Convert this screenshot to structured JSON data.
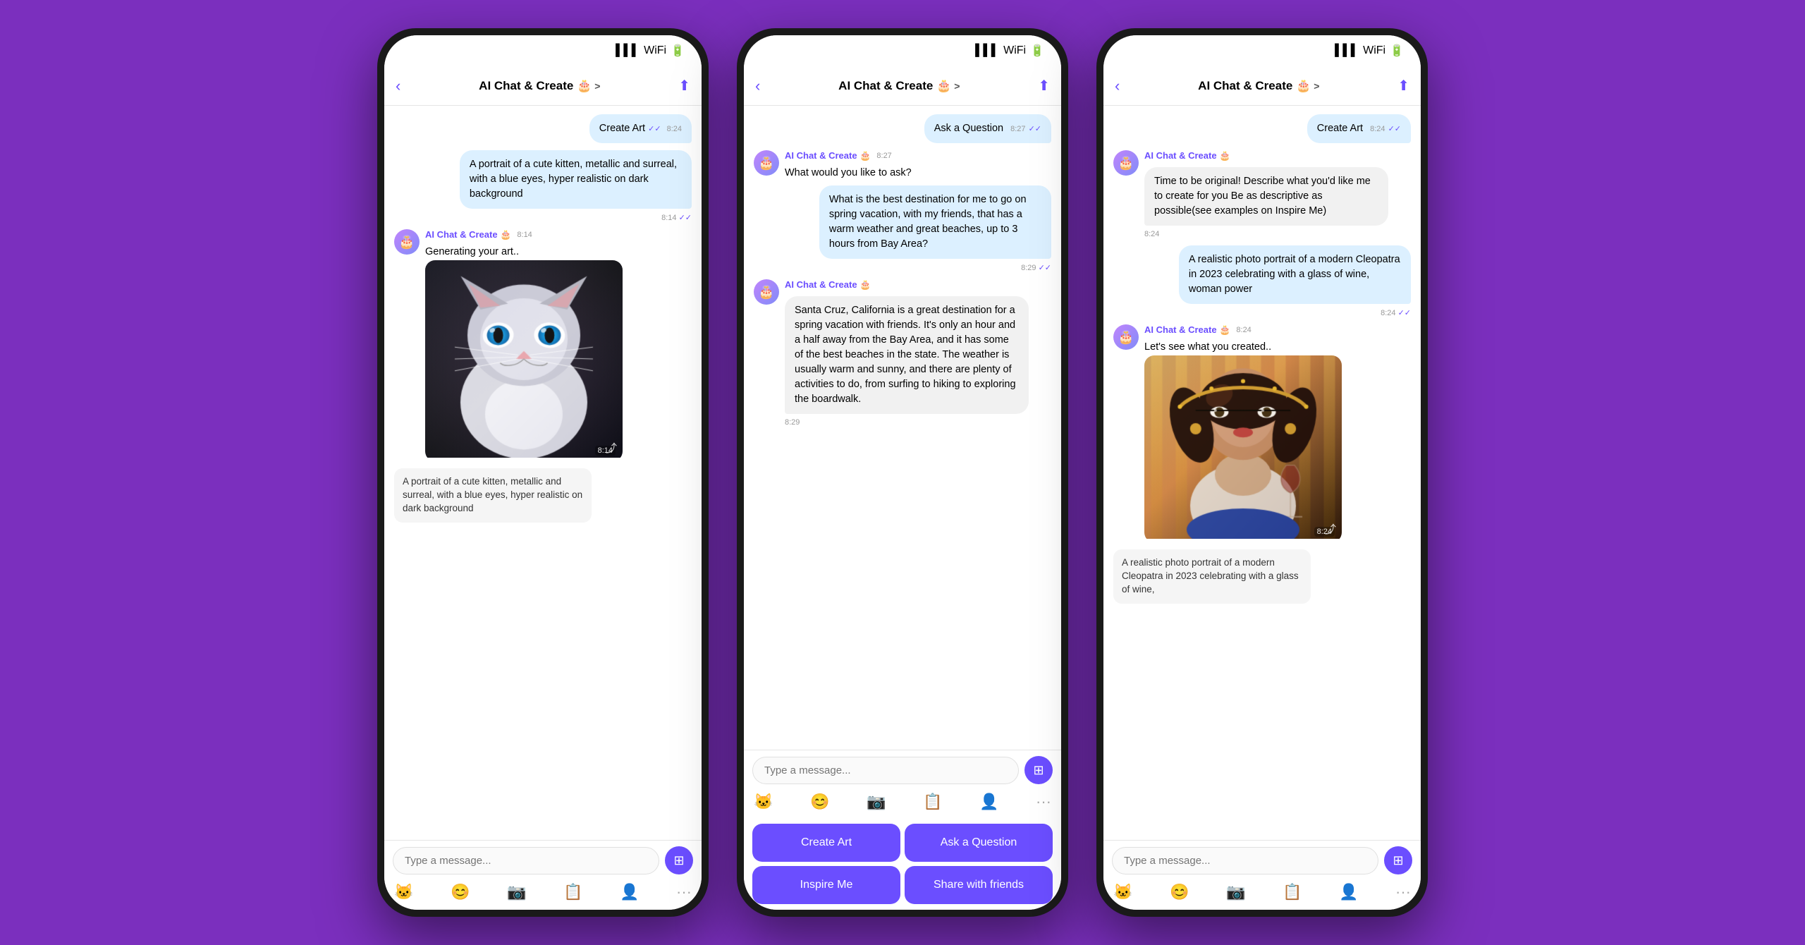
{
  "app": {
    "name": "AI Chat & Create",
    "emoji": "🎂",
    "chevron": ">"
  },
  "phone1": {
    "header": {
      "back": "‹",
      "title": "AI Chat & Create 🎂",
      "chevron": ">",
      "upload": "⬆"
    },
    "messages": [
      {
        "type": "sent",
        "text": "Create Art",
        "time": "8:24",
        "checks": "✓✓"
      },
      {
        "type": "sent",
        "text": "A portrait of a cute kitten, metallic and surreal, with a blue eyes, hyper realistic on dark background",
        "time": "8:14",
        "checks": "✓✓"
      },
      {
        "type": "received",
        "sender": "AI Chat & Create 🎂",
        "senderTime": "8:14",
        "text": "Generating your art..",
        "hasImage": true,
        "imageTime": "8:14"
      },
      {
        "type": "caption",
        "text": "A portrait of a cute kitten, metallic and surreal, with a blue eyes, hyper realistic on dark background"
      }
    ],
    "inputPlaceholder": "Type a message...",
    "toolbarIcons": [
      "😺",
      "😊",
      "📷",
      "📋",
      "👤",
      "···"
    ]
  },
  "phone2": {
    "header": {
      "back": "‹",
      "title": "AI Chat & Create 🎂",
      "chevron": ">",
      "upload": "⬆"
    },
    "messages": [
      {
        "type": "sent",
        "text": "Ask a Question",
        "time": "8:27",
        "checks": "✓✓"
      },
      {
        "type": "received",
        "sender": "AI Chat & Create 🎂",
        "senderTime": "8:27",
        "text": "What would you like to ask?"
      },
      {
        "type": "sent",
        "text": "What is the best destination for me to go on spring vacation, with my friends, that has a warm weather and great beaches, up to 3 hours from Bay Area?",
        "time": "8:29",
        "checks": "✓✓"
      },
      {
        "type": "received",
        "sender": "AI Chat & Create 🎂",
        "senderTime": "8:29",
        "text": "Santa Cruz, California is a great destination for a spring vacation with friends. It's only an hour and a half away from the Bay Area, and it has some of the best beaches in the state. The weather is usually warm and sunny, and there are plenty of activities to do, from surfing to hiking to exploring the boardwalk.",
        "time": "8:29"
      }
    ],
    "inputPlaceholder": "Type a message...",
    "toolbarIcons": [
      "😺",
      "😊",
      "📷",
      "📋",
      "👤",
      "···"
    ],
    "actionButtons": [
      {
        "label": "Create Art",
        "id": "create-art"
      },
      {
        "label": "Ask a Question",
        "id": "ask-question"
      },
      {
        "label": "Inspire Me",
        "id": "inspire-me"
      },
      {
        "label": "Share with friends",
        "id": "share-friends"
      }
    ]
  },
  "phone3": {
    "header": {
      "back": "‹",
      "title": "AI Chat & Create 🎂",
      "chevron": ">",
      "upload": "⬆"
    },
    "messages": [
      {
        "type": "sent",
        "text": "Create Art",
        "time": "8:24",
        "checks": "✓✓"
      },
      {
        "type": "received",
        "sender": "AI Chat & Create 🎂",
        "senderTime": "8:24",
        "text": "Time to be original! Describe what you'd like me to create for you Be as descriptive as possible(see examples on Inspire Me)"
      },
      {
        "type": "sent",
        "text": "A realistic photo portrait of a modern Cleopatra in 2023 celebrating with a glass of wine, woman power",
        "time": "8:24",
        "checks": "✓✓"
      },
      {
        "type": "received",
        "sender": "AI Chat & Create 🎂",
        "senderTime": "8:24",
        "text": "Let's see what you created..",
        "hasImage": true,
        "imageTime": "8:24"
      },
      {
        "type": "caption",
        "text": "A realistic photo portrait of a modern Cleopatra in 2023 celebrating with a glass of wine,"
      }
    ],
    "inputPlaceholder": "Type a message...",
    "toolbarIcons": [
      "😺",
      "😊",
      "📷",
      "📋",
      "👤",
      "···"
    ]
  }
}
